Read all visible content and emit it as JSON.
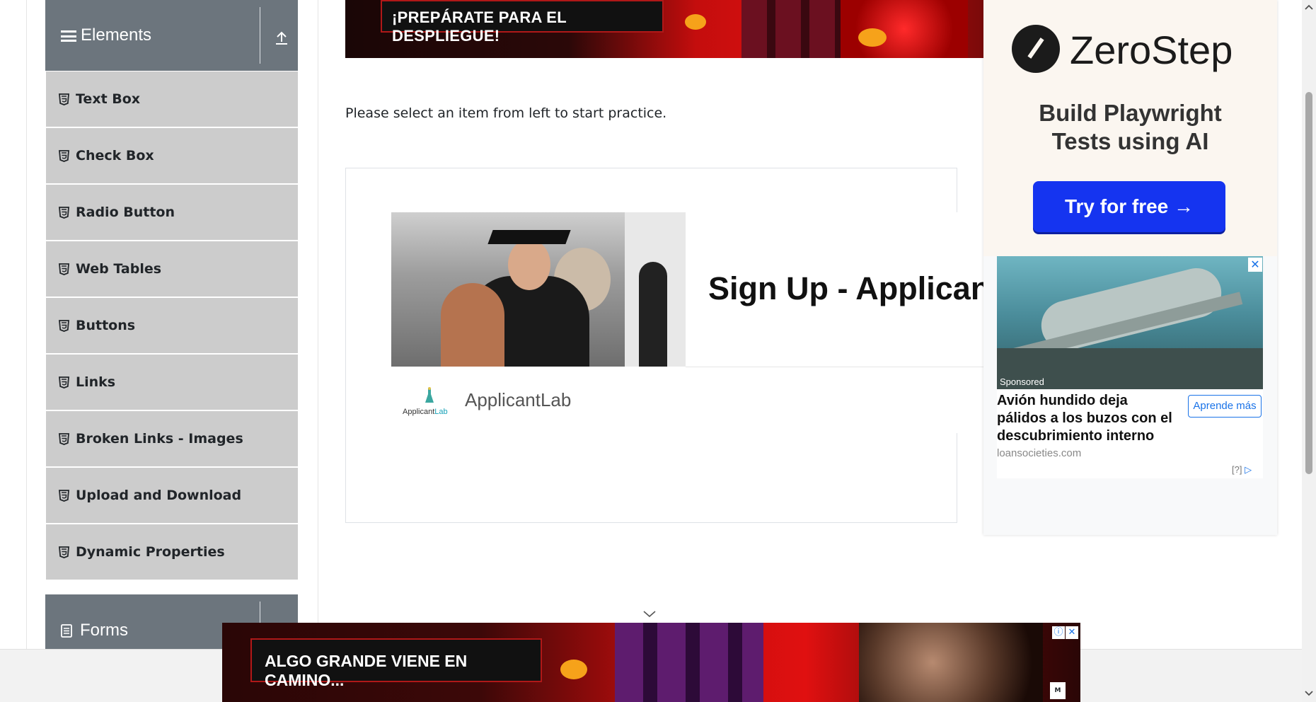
{
  "sidebar": {
    "elements_group": {
      "title": "Elements"
    },
    "items": [
      {
        "label": "Text Box"
      },
      {
        "label": "Check Box"
      },
      {
        "label": "Radio Button"
      },
      {
        "label": "Web Tables"
      },
      {
        "label": "Buttons"
      },
      {
        "label": "Links"
      },
      {
        "label": "Broken Links - Images"
      },
      {
        "label": "Upload and Download"
      },
      {
        "label": "Dynamic Properties"
      }
    ],
    "forms_group": {
      "title": "Forms"
    }
  },
  "top_banner": {
    "text": "¡PREPÁRATE PARA EL DESPLIEGUE!"
  },
  "main": {
    "intro": "Please select an item from left to start practice."
  },
  "signup_ad": {
    "headline": "Sign Up - ApplicantLab",
    "logo_text_a": "Applicant",
    "logo_text_b": "Lab",
    "brand": "ApplicantLab"
  },
  "zerostep_ad": {
    "name": "ZeroStep",
    "tagline_line1": "Build Playwright",
    "tagline_line2": "Tests using AI",
    "cta": "Try for free →"
  },
  "native_ad": {
    "close": "✕",
    "sponsored": "Sponsored",
    "headline": "Avión hundido deja pálidos a los buzos con el descubrimiento interno",
    "button": "Aprende más",
    "domain": "loansocieties.com",
    "adchoices": "[?]"
  },
  "bottom_banner": {
    "text": "ALGO GRANDE VIENE EN CAMINO...",
    "info": "ⓘ",
    "close": "✕",
    "rating": "M"
  },
  "colors": {
    "group_header": "#6c757d",
    "menu_item": "#cccccc",
    "cta_blue": "#1534f0",
    "link_blue": "#1a73e8"
  }
}
